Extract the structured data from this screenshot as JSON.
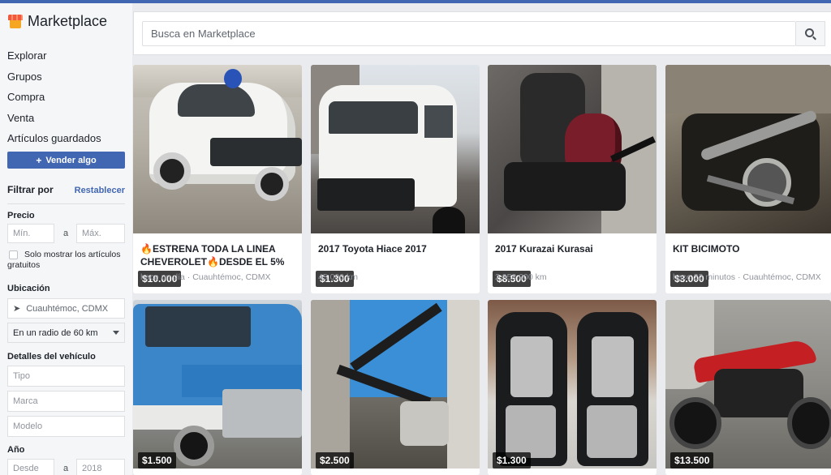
{
  "app": {
    "title": "Marketplace"
  },
  "nav": {
    "items": [
      "Explorar",
      "Grupos",
      "Compra",
      "Venta",
      "Artículos guardados"
    ],
    "sell_button": "Vender algo"
  },
  "filters": {
    "title": "Filtrar por",
    "reset": "Restablecer",
    "price": {
      "label": "Precio",
      "min_placeholder": "Mín.",
      "separator": "a",
      "max_placeholder": "Máx."
    },
    "free_only": {
      "label": "Solo mostrar los artículos gratuitos",
      "checked": false
    },
    "location": {
      "label": "Ubicación",
      "value": "Cuauhtémoc, CDMX",
      "radius": "En un radio de 60 km"
    },
    "vehicle": {
      "label": "Detalles del vehículo",
      "type_placeholder": "Tipo",
      "brand_placeholder": "Marca",
      "model_placeholder": "Modelo"
    },
    "year": {
      "label": "Año",
      "from_placeholder": "Desde",
      "separator": "a",
      "to_value": "2018"
    }
  },
  "search": {
    "placeholder": "Busca en Marketplace"
  },
  "listings": [
    {
      "price": "$10.000",
      "title": "🔥ESTRENA TODA LA LINEA CHEVEROLET🔥DESDE EL 5% D…",
      "meta": "hace un día · Cuauhtémoc, CDMX"
    },
    {
      "price": "$1.300",
      "title": "2017 Toyota Hiace 2017",
      "meta": "45.000 km"
    },
    {
      "price": "$8.500",
      "title": "2017 Kurazai Kurasai",
      "meta": "2.953.000 km"
    },
    {
      "price": "$3.000",
      "title": "KIT BICIMOTO",
      "meta": "hace 22 minutos · Cuauhtémoc, CDMX"
    },
    {
      "price": "$1.500",
      "title": "",
      "meta": ""
    },
    {
      "price": "$2.500",
      "title": "",
      "meta": ""
    },
    {
      "price": "$1.300",
      "title": "",
      "meta": ""
    },
    {
      "price": "$13.500",
      "title": "",
      "meta": ""
    }
  ],
  "colors": {
    "brand_blue": "#4267b2",
    "background": "#e9ebee",
    "sidebar": "#f5f6f7"
  },
  "icons": {
    "brand": "marketplace-store-icon",
    "location": "location-arrow-icon",
    "search": "search-icon",
    "radius": "chevron-down-icon"
  }
}
